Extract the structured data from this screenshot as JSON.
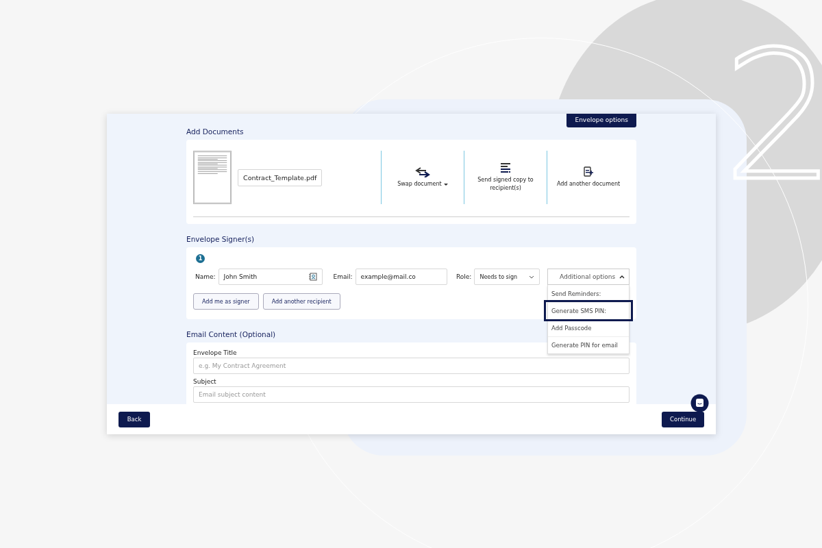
{
  "decoration": {
    "step_number": "2"
  },
  "header_button": "Envelope options",
  "documents": {
    "title": "Add Documents",
    "file_name": "Contract_Template.pdf",
    "actions": [
      {
        "kind": "swap",
        "label": "Swap document"
      },
      {
        "kind": "send-copy",
        "label": "Send signed copy to recipient(s)"
      },
      {
        "kind": "add",
        "label": "Add another document"
      }
    ]
  },
  "signers": {
    "title": "Envelope Signer(s)",
    "items": [
      {
        "number": "1",
        "name_label": "Name:",
        "name": "John Smith",
        "email_label": "Email:",
        "email": "example@mail.co",
        "role_label": "Role:",
        "role": "Needs to sign"
      }
    ],
    "options": {
      "label": "Additional options",
      "expanded": true,
      "items": [
        {
          "label": "Send Reminders:",
          "selected": false
        },
        {
          "label": "Generate SMS PIN:",
          "selected": true
        },
        {
          "label": "Add Passcode",
          "selected": false
        },
        {
          "label": "Generate PIN for email",
          "selected": false
        }
      ]
    },
    "buttons": [
      "Add me as signer",
      "Add another recipient"
    ]
  },
  "email_content": {
    "title": "Email Content (Optional)",
    "fields": [
      {
        "label": "Envelope Title",
        "placeholder": "e.g. My Contract Agreement"
      },
      {
        "label": "Subject",
        "placeholder": "Email subject content"
      }
    ]
  },
  "footer": {
    "back": "Back",
    "continue": "Continue"
  }
}
